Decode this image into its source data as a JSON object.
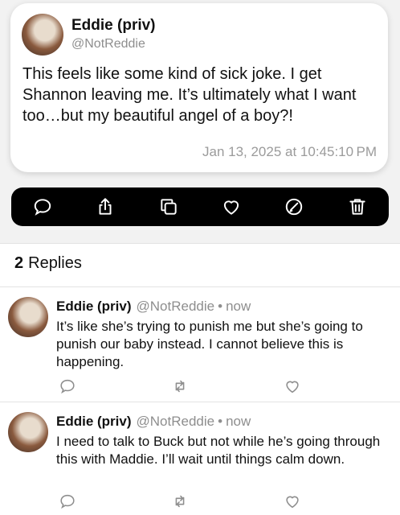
{
  "post": {
    "author_name": "Eddie (priv)",
    "author_handle": "@NotReddie",
    "body": "This feels like some kind of sick joke. I get Shannon leaving me. It’s ultimately what I want too…but my beautiful angel of a boy?!",
    "timestamp": "Jan 13, 2025 at 10:45:10 PM"
  },
  "action_bar": {
    "icons": [
      "reply-icon",
      "share-icon",
      "copy-icon",
      "like-icon",
      "edit-icon",
      "delete-icon"
    ]
  },
  "replies": {
    "count": "2",
    "label": "Replies",
    "items": [
      {
        "author_name": "Eddie (priv)",
        "author_handle": "@NotReddie",
        "separator": "•",
        "time": "now",
        "body": "It’s like she’s trying to punish me but she’s going to punish our baby instead. I cannot believe this is happening."
      },
      {
        "author_name": "Eddie (priv)",
        "author_handle": "@NotReddie",
        "separator": "•",
        "time": "now",
        "body": "I need to talk to Buck but not while he’s going through this with Maddie. I’ll wait until things calm down."
      }
    ]
  }
}
